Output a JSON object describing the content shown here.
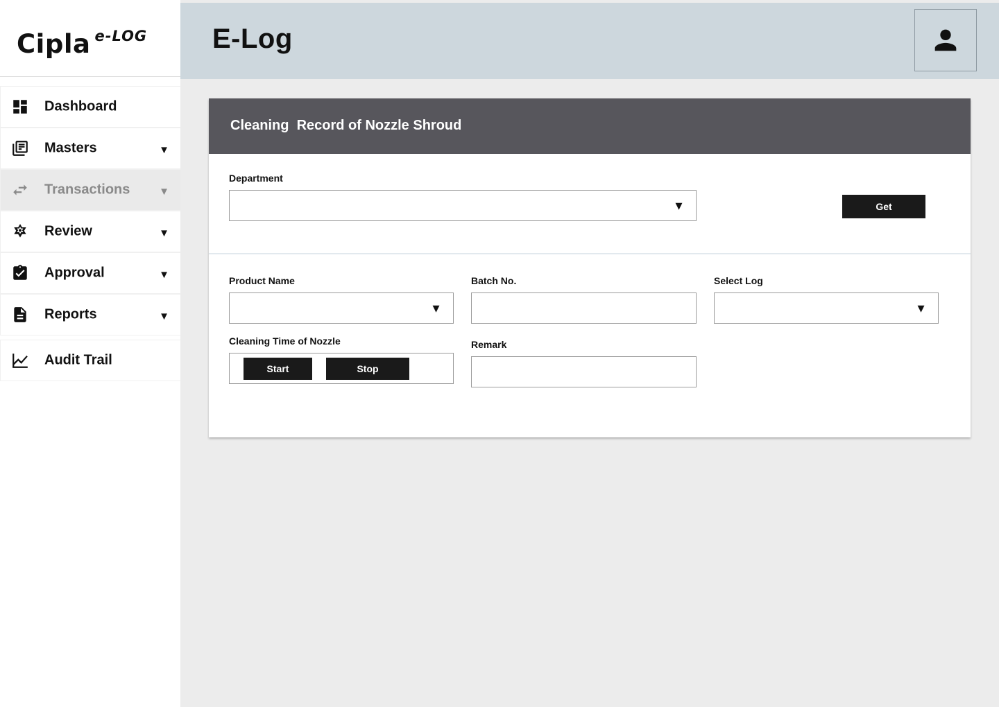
{
  "brand": {
    "name": "Cipla",
    "suffix": "e-LOG"
  },
  "header": {
    "title": "E-Log"
  },
  "sidebar": {
    "items": [
      {
        "label": "Dashboard",
        "icon": "dashboard-icon",
        "has_caret": false,
        "active": false
      },
      {
        "label": "Masters",
        "icon": "library-books-icon",
        "has_caret": true,
        "active": false
      },
      {
        "label": "Transactions",
        "icon": "swap-arrows-icon",
        "has_caret": true,
        "active": true
      },
      {
        "label": "Review",
        "icon": "star-settings-icon",
        "has_caret": true,
        "active": false
      },
      {
        "label": "Approval",
        "icon": "clipboard-check-icon",
        "has_caret": true,
        "active": false
      },
      {
        "label": "Reports",
        "icon": "document-icon",
        "has_caret": true,
        "active": false
      },
      {
        "label": "Audit Trail",
        "icon": "trending-chart-icon",
        "has_caret": false,
        "active": false
      }
    ],
    "caret": "▼"
  },
  "form": {
    "title": "Cleaning  Record of Nozzle Shroud",
    "department": {
      "label": "Department",
      "value": ""
    },
    "get_button": "Get",
    "product_name": {
      "label": "Product Name",
      "value": ""
    },
    "batch_no": {
      "label": "Batch No.",
      "value": ""
    },
    "select_log": {
      "label": "Select Log",
      "value": ""
    },
    "cleaning_time": {
      "label": "Cleaning Time of Nozzle",
      "start": "Start",
      "stop": "Stop"
    },
    "remark": {
      "label": "Remark",
      "value": ""
    }
  },
  "colors": {
    "topbar": "#cdd7dd",
    "card_header": "#57565c",
    "button": "#1a1a1a",
    "page_bg": "#ececec",
    "active_nav": "#eaeaea"
  }
}
